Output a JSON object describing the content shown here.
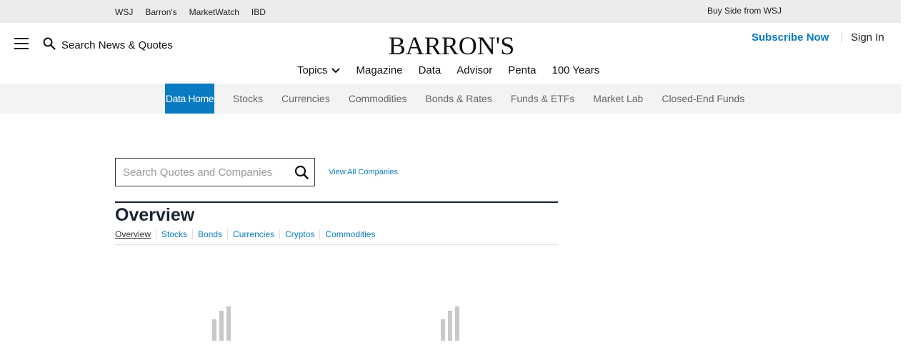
{
  "topbar": {
    "links": [
      "WSJ",
      "Barron's",
      "MarketWatch",
      "IBD"
    ],
    "buy_side": "Buy Side from WSJ"
  },
  "header": {
    "search_label": "Search News & Quotes",
    "logo": "BARRON'S",
    "subscribe": "Subscribe Now",
    "sign_in": "Sign In"
  },
  "main_nav": {
    "topics": "Topics",
    "items": [
      "Magazine",
      "Data",
      "Advisor",
      "Penta",
      "100 Years"
    ]
  },
  "data_nav": {
    "active": "Data Home",
    "items": [
      "Stocks",
      "Currencies",
      "Commodities",
      "Bonds & Rates",
      "Funds & ETFs",
      "Market Lab",
      "Closed-End Funds"
    ]
  },
  "quote_search": {
    "placeholder": "Search Quotes and Companies",
    "value": "",
    "view_all": "View All Companies"
  },
  "overview": {
    "title": "Overview",
    "tabs": [
      "Overview",
      "Stocks",
      "Bonds",
      "Currencies",
      "Cryptos",
      "Commodities"
    ]
  },
  "colors": {
    "accent": "#0a7bc2",
    "heading": "#1a2433",
    "loader": "#c8c8c8"
  }
}
